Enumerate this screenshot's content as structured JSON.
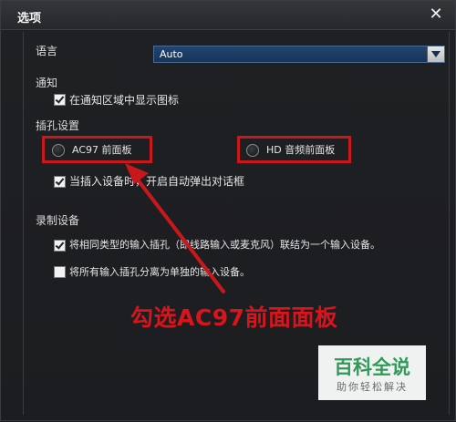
{
  "dialog": {
    "title": "选项",
    "close_icon": "close-icon"
  },
  "language": {
    "label": "语言",
    "selected": "Auto"
  },
  "notification": {
    "section": "通知",
    "show_icon_label": "在通知区域中显示图标",
    "show_icon_checked": true
  },
  "jack": {
    "section": "插孔设置",
    "ac97_label": "AC97 前面板",
    "hd_label": "HD 音频前面板",
    "auto_popup_label": "当插入设备时，开启自动弹出对话框",
    "auto_popup_checked": true
  },
  "recording": {
    "section": "录制设备",
    "merge_label": "将相同类型的输入插孔（即线路输入或麦克风）联结为一个输入设备。",
    "merge_checked": true,
    "separate_label": "将所有输入插孔分离为单独的输入设备。",
    "separate_checked": false
  },
  "annotation": {
    "text": "勾选AC97前面面板",
    "color": "#d9141b"
  },
  "watermark": {
    "line1": "百科全说",
    "line2": "助你轻松解决"
  },
  "colors": {
    "highlight": "#c8181c",
    "select_bg": "#1e3d66"
  }
}
